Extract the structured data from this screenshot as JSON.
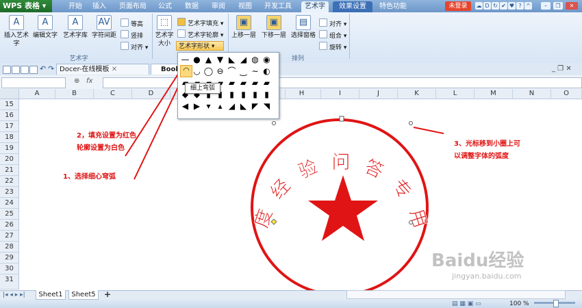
{
  "app": {
    "logo": "WPS 表格",
    "login": "未登录"
  },
  "tabs": [
    {
      "label": "开始"
    },
    {
      "label": "插入"
    },
    {
      "label": "页面布局"
    },
    {
      "label": "公式"
    },
    {
      "label": "数据"
    },
    {
      "label": "审阅"
    },
    {
      "label": "视图"
    },
    {
      "label": "开发工具"
    },
    {
      "label": "艺术字"
    },
    {
      "label": "效果设置"
    },
    {
      "label": "特色功能"
    }
  ],
  "ribbon": {
    "insert_art": "插入艺术字",
    "edit_text": "编辑文字",
    "art_lib": "艺术字库",
    "char_spacing": "字符间距",
    "equal_height": "等高",
    "vertical": "竖排",
    "align": "对齐",
    "group_art": "艺术字",
    "art_size": "艺术字大小",
    "fill": "艺术字填充",
    "outline": "艺术字轮廓",
    "shape": "艺术字形状",
    "bring_forward": "上移一层",
    "send_backward": "下移一层",
    "select_pane": "选择窗格",
    "align2": "对齐",
    "combine": "组合",
    "rotate": "旋转",
    "group_arrange": "排列"
  },
  "doc_tabs": {
    "docer": "Docer-在线模板",
    "book": "Book"
  },
  "columns": [
    "A",
    "B",
    "C",
    "D",
    "E",
    "F",
    "G",
    "H",
    "I",
    "J",
    "K",
    "L",
    "M",
    "N",
    "O"
  ],
  "rows": [
    "15",
    "16",
    "17",
    "18",
    "19",
    "20",
    "21",
    "22",
    "23",
    "24",
    "25",
    "26",
    "27",
    "28",
    "29",
    "30",
    "31"
  ],
  "gallery": {
    "tooltip": "细上弯弧"
  },
  "annotations": {
    "a1": "1、选择细心穹弧",
    "a2_line1": "2，填充设置为红色",
    "a2_line2": "轮廓设置为白色",
    "a3_line1": "3、光标移到小圈上可",
    "a3_line2": "以调整字体的弧度"
  },
  "seal": {
    "text": "百度经验问答专用章",
    "color": "#e01414"
  },
  "sheets": [
    {
      "label": "Sheet1"
    },
    {
      "label": "Sheet5"
    }
  ],
  "status": {
    "zoom": "100 %"
  },
  "watermark": {
    "brand": "Baidu",
    "brand_cn": "经验",
    "url": "jingyan.baidu.com"
  }
}
